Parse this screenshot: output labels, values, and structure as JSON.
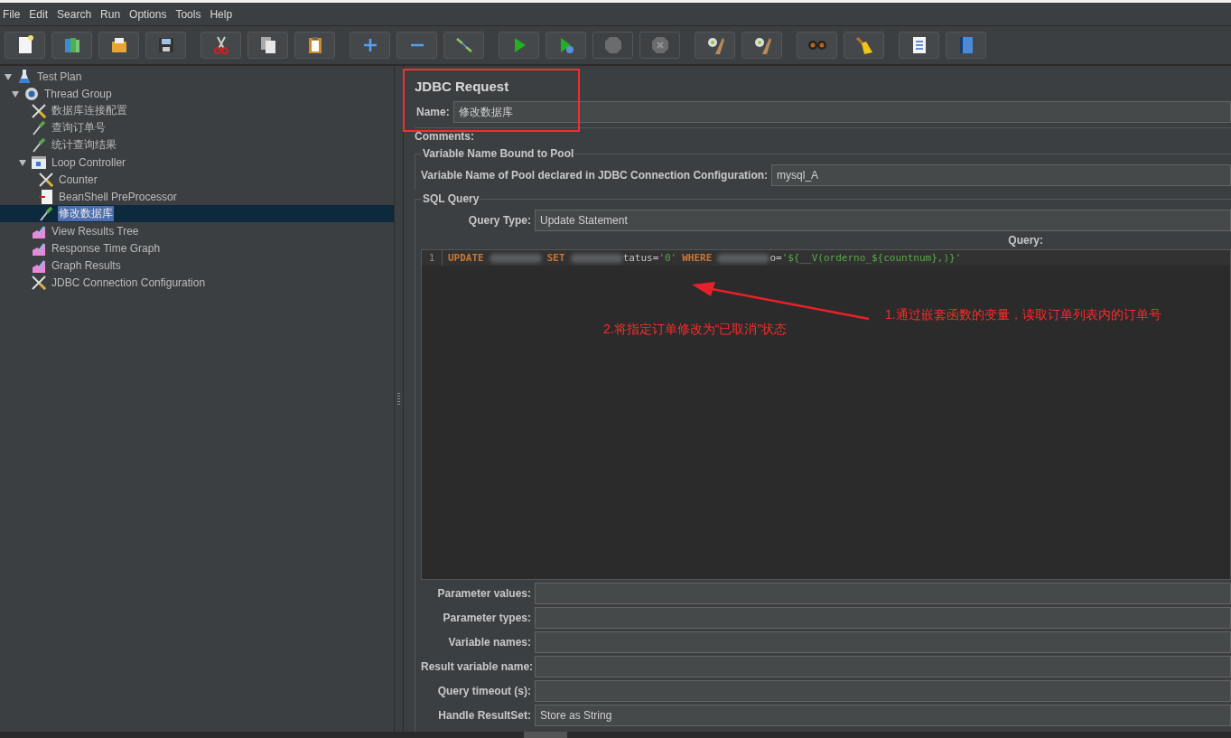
{
  "menu": [
    "File",
    "Edit",
    "Search",
    "Run",
    "Options",
    "Tools",
    "Help"
  ],
  "toolbar": [
    [
      {
        "kind": "new",
        "disabled": false
      },
      {
        "kind": "templates",
        "disabled": false
      },
      {
        "kind": "open",
        "disabled": false
      },
      {
        "kind": "save",
        "disabled": false
      }
    ],
    [
      {
        "kind": "cut",
        "disabled": false
      },
      {
        "kind": "copy",
        "disabled": false
      },
      {
        "kind": "paste",
        "disabled": false
      }
    ],
    [
      {
        "kind": "expand",
        "disabled": false
      },
      {
        "kind": "collapse",
        "disabled": false
      },
      {
        "kind": "toggle",
        "disabled": false
      }
    ],
    [
      {
        "kind": "start",
        "disabled": false
      },
      {
        "kind": "start-no-pause",
        "disabled": false
      },
      {
        "kind": "stop",
        "disabled": true
      },
      {
        "kind": "shutdown",
        "disabled": true
      }
    ],
    [
      {
        "kind": "clear",
        "disabled": false
      },
      {
        "kind": "clear-all",
        "disabled": false
      }
    ],
    [
      {
        "kind": "search",
        "disabled": false
      },
      {
        "kind": "reset-search",
        "disabled": false
      }
    ],
    [
      {
        "kind": "log",
        "disabled": false
      },
      {
        "kind": "help",
        "disabled": false
      }
    ]
  ],
  "tree": [
    {
      "label": "Test Plan",
      "kind": "testplan",
      "selected": false,
      "expanded": true,
      "children": [
        {
          "label": "Thread Group",
          "kind": "gear",
          "selected": false,
          "expanded": true,
          "children": [
            {
              "label": "数据库连接配置",
              "kind": "config",
              "selected": false
            },
            {
              "label": "查询订单号",
              "kind": "sampler",
              "selected": false
            },
            {
              "label": "统计查询结果",
              "kind": "sampler",
              "selected": false
            },
            {
              "label": "Loop Controller",
              "kind": "loop",
              "selected": false,
              "expanded": true,
              "children": [
                {
                  "label": "Counter",
                  "kind": "config",
                  "selected": false
                },
                {
                  "label": "BeanShell PreProcessor",
                  "kind": "preprocessor",
                  "selected": false
                },
                {
                  "label": "修改数据库",
                  "kind": "sampler",
                  "selected": true
                }
              ]
            },
            {
              "label": "View Results Tree",
              "kind": "listener",
              "selected": false
            },
            {
              "label": "Response Time Graph",
              "kind": "listener",
              "selected": false
            },
            {
              "label": "Graph Results",
              "kind": "listener",
              "selected": false
            },
            {
              "label": "JDBC Connection Configuration",
              "kind": "config",
              "selected": false
            }
          ]
        }
      ]
    }
  ],
  "panel": {
    "title": "JDBC Request",
    "name_label": "Name:",
    "name_value": "修改数据库",
    "comments_label": "Comments:",
    "pool_section": {
      "title": "Variable Name Bound to Pool",
      "label": "Variable Name of Pool declared in JDBC Connection Configuration:",
      "value": "mysql_A"
    },
    "sql_section": {
      "title": "SQL Query",
      "query_type_label": "Query Type:",
      "query_type_value": "Update Statement",
      "query_label": "Query:",
      "lines": [
        {
          "number": "1",
          "tokens": [
            {
              "kind": "keyword",
              "text": "UPDATE"
            },
            {
              "kind": "redacted"
            },
            {
              "kind": "keyword",
              "text": "SET"
            },
            {
              "kind": "redacted"
            },
            {
              "kind": "plain",
              "text": "tatus="
            },
            {
              "kind": "string",
              "text": "'0'"
            },
            {
              "kind": "keyword",
              "text": "WHERE"
            },
            {
              "kind": "redacted"
            },
            {
              "kind": "plain",
              "text": "o="
            },
            {
              "kind": "string",
              "text": "'${__V(orderno_${countnum},)}'"
            }
          ]
        }
      ]
    },
    "fields": [
      {
        "label": "Parameter values:"
      },
      {
        "label": "Parameter types:"
      },
      {
        "label": "Variable names:"
      },
      {
        "label": "Result variable name:"
      },
      {
        "label": "Query timeout (s):"
      },
      {
        "label": "Handle ResultSet:",
        "value": "Store as String"
      }
    ]
  },
  "annotations": [
    {
      "kind": "arrow-note",
      "text": "1.通过嵌套函数的变量，读取订单列表内的订单号"
    },
    {
      "kind": "note",
      "text": "2.将指定订单修改为“已取消”状态"
    }
  ]
}
